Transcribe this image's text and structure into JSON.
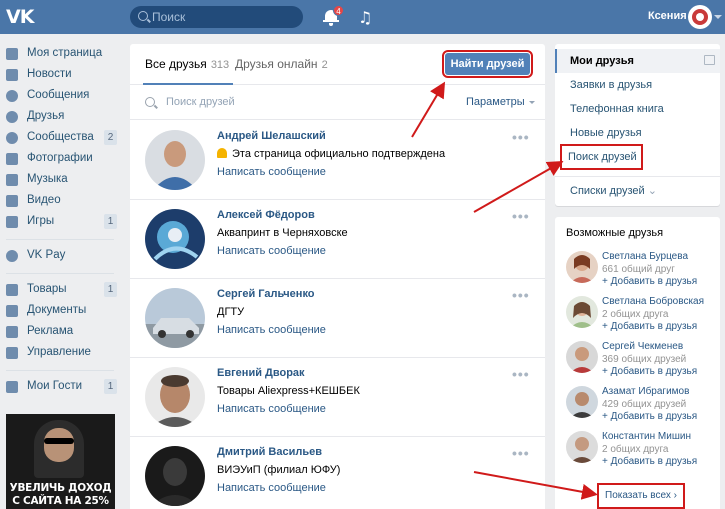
{
  "header": {
    "logo": "VK",
    "search_placeholder": "Поиск",
    "notifications_count": "4",
    "user_name": "Ксения"
  },
  "leftnav": {
    "items": [
      {
        "label": "Моя страница",
        "icon": "home-icon"
      },
      {
        "label": "Новости",
        "icon": "news-icon"
      },
      {
        "label": "Сообщения",
        "icon": "messages-icon"
      },
      {
        "label": "Друзья",
        "icon": "friends-icon"
      },
      {
        "label": "Сообщества",
        "icon": "communities-icon",
        "count": "2"
      },
      {
        "label": "Фотографии",
        "icon": "camera-icon"
      },
      {
        "label": "Музыка",
        "icon": "music-icon"
      },
      {
        "label": "Видео",
        "icon": "video-icon"
      },
      {
        "label": "Игры",
        "icon": "games-icon",
        "count": "1"
      }
    ],
    "vkpay": {
      "label": "VK Pay",
      "icon": "vkpay-icon"
    },
    "items2": [
      {
        "label": "Товары",
        "icon": "goods-icon",
        "count": "1"
      },
      {
        "label": "Документы",
        "icon": "documents-icon"
      },
      {
        "label": "Реклама",
        "icon": "ads-icon"
      },
      {
        "label": "Управление",
        "icon": "gamepad-icon"
      }
    ],
    "guests": {
      "label": "Мои Гости",
      "icon": "guests-icon",
      "count": "1"
    },
    "ad": {
      "line1": "УВЕЛИЧЬ ДОХОД",
      "line2": "С САЙТА НА 25%"
    }
  },
  "main": {
    "tabs": [
      {
        "label": "Все друзья",
        "count": "313"
      },
      {
        "label": "Друзья онлайн",
        "count": "2"
      }
    ],
    "find_friends_button": "Найти друзей",
    "search_placeholder": "Поиск друзей",
    "params_label": "Параметры",
    "friends": [
      {
        "name": "Андрей Шелашский",
        "sub": "Эта страница официально подтверждена",
        "verified": true,
        "message": "Написать сообщение",
        "more": "•••"
      },
      {
        "name": "Алексей Фёдоров",
        "sub": "Аквапринт в Черняховске",
        "message": "Написать сообщение",
        "more": "•••"
      },
      {
        "name": "Сергей Гальченко",
        "sub": "ДГТУ",
        "message": "Написать сообщение",
        "more": "•••"
      },
      {
        "name": "Евгений Дворак",
        "sub": "Товары Aliexpress+КЕШБЕК",
        "message": "Написать сообщение",
        "more": "•••"
      },
      {
        "name": "Дмитрий Васильев",
        "sub": "ВИЭУиП (филиал ЮФУ)",
        "message": "Написать сообщение",
        "more": "•••"
      }
    ]
  },
  "rightmenu": {
    "items": [
      {
        "label": "Мои друзья",
        "active": true
      },
      {
        "label": "Заявки в друзья"
      },
      {
        "label": "Телефонная книга"
      },
      {
        "label": "Новые друзья"
      },
      {
        "label": "Поиск друзей",
        "highlighted": true
      }
    ],
    "lists_label": "Списки друзей"
  },
  "possible": {
    "title": "Возможные друзья",
    "people": [
      {
        "name": "Светлана Бурцева",
        "info": "661 общий друг",
        "add": "+ Добавить в друзья"
      },
      {
        "name": "Светлана Бобровская",
        "info": "2 общих друга",
        "add": "+ Добавить в друзья"
      },
      {
        "name": "Сергей Чекменев",
        "info": "369 общих друзей",
        "add": "+ Добавить в друзья"
      },
      {
        "name": "Азамат Ибрагимов",
        "info": "429 общих друзей",
        "add": "+ Добавить в друзья"
      },
      {
        "name": "Константин Мишин",
        "info": "2 общих друга",
        "add": "+ Добавить в друзья"
      }
    ],
    "show_all": "Показать всех"
  },
  "colors": {
    "header": "#4a76a8",
    "accent": "#5181b8",
    "link": "#2a5885",
    "highlight": "#d01a1a"
  }
}
